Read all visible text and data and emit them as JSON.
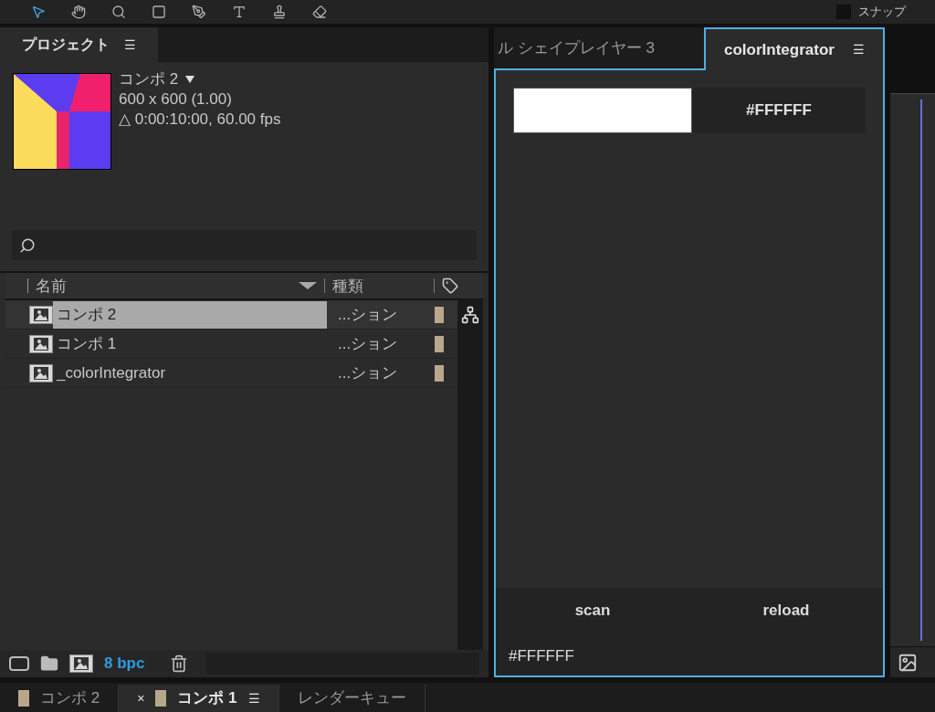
{
  "toolbar": {
    "snap_label": "スナップ",
    "snap_checked": false
  },
  "project_panel": {
    "tab": {
      "label": "プロジェクト",
      "menu": "☰"
    },
    "preview": {
      "title": "コンポ 2",
      "dimensions": "600 x 600 (1.00)",
      "duration": "△ 0:00:10:00, 60.00 fps"
    },
    "columns": [
      {
        "label": "名前",
        "sorted": true
      },
      {
        "label": "種類",
        "sorted": false
      }
    ],
    "items": [
      {
        "name": "コンポ 2",
        "type": "...ション",
        "selected": true,
        "color": "#b9a78b",
        "flowchart": true
      },
      {
        "name": "コンポ 1",
        "type": "...ション",
        "selected": false,
        "color": "#b9a78b",
        "flowchart": false
      },
      {
        "name": "_colorIntegrator",
        "type": "...ション",
        "selected": false,
        "color": "#b9a78b",
        "flowchart": false
      }
    ],
    "footer": {
      "bit_depth": "8 bpc"
    }
  },
  "plugin_panel": {
    "tabs": [
      {
        "label": "ル シェイプレイヤー 3",
        "selected": false
      },
      {
        "label": "colorIntegrator",
        "selected": true,
        "menu": "☰"
      }
    ],
    "swatch": {
      "color": "#ffffff"
    },
    "hex_value": "#FFFFFF",
    "buttons": [
      "scan",
      "reload"
    ],
    "status": "#FFFFFF"
  },
  "bottom_tabs": [
    {
      "label": "コンポ 2",
      "selected": false,
      "color": "#b9a78b"
    },
    {
      "label": "コンポ 1",
      "selected": true,
      "color": "#b9a78b",
      "close": "×",
      "menu": "☰"
    },
    {
      "label": "レンダーキュー",
      "selected": false
    }
  ]
}
